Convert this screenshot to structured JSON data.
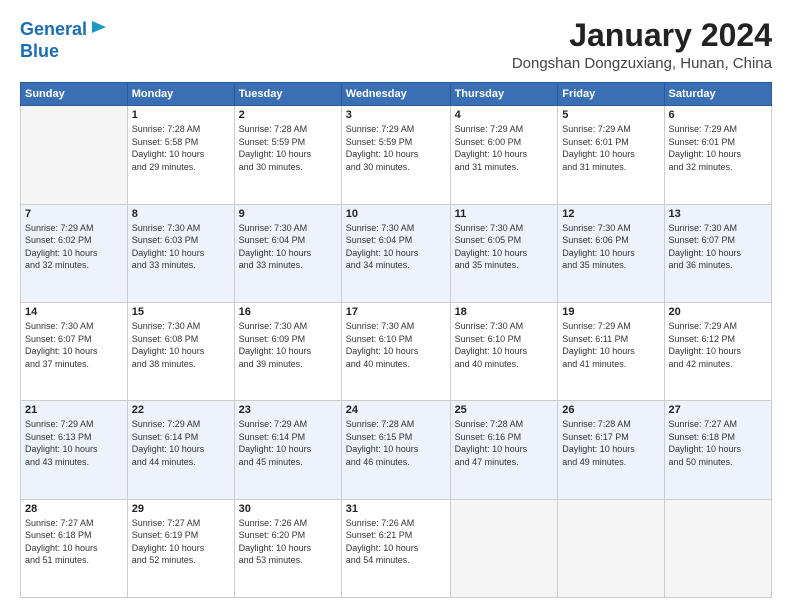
{
  "header": {
    "logo_line1": "General",
    "logo_line2": "Blue",
    "month_title": "January 2024",
    "location": "Dongshan Dongzuxiang, Hunan, China"
  },
  "weekdays": [
    "Sunday",
    "Monday",
    "Tuesday",
    "Wednesday",
    "Thursday",
    "Friday",
    "Saturday"
  ],
  "weeks": [
    [
      {
        "day": "",
        "info": ""
      },
      {
        "day": "1",
        "info": "Sunrise: 7:28 AM\nSunset: 5:58 PM\nDaylight: 10 hours\nand 29 minutes."
      },
      {
        "day": "2",
        "info": "Sunrise: 7:28 AM\nSunset: 5:59 PM\nDaylight: 10 hours\nand 30 minutes."
      },
      {
        "day": "3",
        "info": "Sunrise: 7:29 AM\nSunset: 5:59 PM\nDaylight: 10 hours\nand 30 minutes."
      },
      {
        "day": "4",
        "info": "Sunrise: 7:29 AM\nSunset: 6:00 PM\nDaylight: 10 hours\nand 31 minutes."
      },
      {
        "day": "5",
        "info": "Sunrise: 7:29 AM\nSunset: 6:01 PM\nDaylight: 10 hours\nand 31 minutes."
      },
      {
        "day": "6",
        "info": "Sunrise: 7:29 AM\nSunset: 6:01 PM\nDaylight: 10 hours\nand 32 minutes."
      }
    ],
    [
      {
        "day": "7",
        "info": "Sunrise: 7:29 AM\nSunset: 6:02 PM\nDaylight: 10 hours\nand 32 minutes."
      },
      {
        "day": "8",
        "info": "Sunrise: 7:30 AM\nSunset: 6:03 PM\nDaylight: 10 hours\nand 33 minutes."
      },
      {
        "day": "9",
        "info": "Sunrise: 7:30 AM\nSunset: 6:04 PM\nDaylight: 10 hours\nand 33 minutes."
      },
      {
        "day": "10",
        "info": "Sunrise: 7:30 AM\nSunset: 6:04 PM\nDaylight: 10 hours\nand 34 minutes."
      },
      {
        "day": "11",
        "info": "Sunrise: 7:30 AM\nSunset: 6:05 PM\nDaylight: 10 hours\nand 35 minutes."
      },
      {
        "day": "12",
        "info": "Sunrise: 7:30 AM\nSunset: 6:06 PM\nDaylight: 10 hours\nand 35 minutes."
      },
      {
        "day": "13",
        "info": "Sunrise: 7:30 AM\nSunset: 6:07 PM\nDaylight: 10 hours\nand 36 minutes."
      }
    ],
    [
      {
        "day": "14",
        "info": "Sunrise: 7:30 AM\nSunset: 6:07 PM\nDaylight: 10 hours\nand 37 minutes."
      },
      {
        "day": "15",
        "info": "Sunrise: 7:30 AM\nSunset: 6:08 PM\nDaylight: 10 hours\nand 38 minutes."
      },
      {
        "day": "16",
        "info": "Sunrise: 7:30 AM\nSunset: 6:09 PM\nDaylight: 10 hours\nand 39 minutes."
      },
      {
        "day": "17",
        "info": "Sunrise: 7:30 AM\nSunset: 6:10 PM\nDaylight: 10 hours\nand 40 minutes."
      },
      {
        "day": "18",
        "info": "Sunrise: 7:30 AM\nSunset: 6:10 PM\nDaylight: 10 hours\nand 40 minutes."
      },
      {
        "day": "19",
        "info": "Sunrise: 7:29 AM\nSunset: 6:11 PM\nDaylight: 10 hours\nand 41 minutes."
      },
      {
        "day": "20",
        "info": "Sunrise: 7:29 AM\nSunset: 6:12 PM\nDaylight: 10 hours\nand 42 minutes."
      }
    ],
    [
      {
        "day": "21",
        "info": "Sunrise: 7:29 AM\nSunset: 6:13 PM\nDaylight: 10 hours\nand 43 minutes."
      },
      {
        "day": "22",
        "info": "Sunrise: 7:29 AM\nSunset: 6:14 PM\nDaylight: 10 hours\nand 44 minutes."
      },
      {
        "day": "23",
        "info": "Sunrise: 7:29 AM\nSunset: 6:14 PM\nDaylight: 10 hours\nand 45 minutes."
      },
      {
        "day": "24",
        "info": "Sunrise: 7:28 AM\nSunset: 6:15 PM\nDaylight: 10 hours\nand 46 minutes."
      },
      {
        "day": "25",
        "info": "Sunrise: 7:28 AM\nSunset: 6:16 PM\nDaylight: 10 hours\nand 47 minutes."
      },
      {
        "day": "26",
        "info": "Sunrise: 7:28 AM\nSunset: 6:17 PM\nDaylight: 10 hours\nand 49 minutes."
      },
      {
        "day": "27",
        "info": "Sunrise: 7:27 AM\nSunset: 6:18 PM\nDaylight: 10 hours\nand 50 minutes."
      }
    ],
    [
      {
        "day": "28",
        "info": "Sunrise: 7:27 AM\nSunset: 6:18 PM\nDaylight: 10 hours\nand 51 minutes."
      },
      {
        "day": "29",
        "info": "Sunrise: 7:27 AM\nSunset: 6:19 PM\nDaylight: 10 hours\nand 52 minutes."
      },
      {
        "day": "30",
        "info": "Sunrise: 7:26 AM\nSunset: 6:20 PM\nDaylight: 10 hours\nand 53 minutes."
      },
      {
        "day": "31",
        "info": "Sunrise: 7:26 AM\nSunset: 6:21 PM\nDaylight: 10 hours\nand 54 minutes."
      },
      {
        "day": "",
        "info": ""
      },
      {
        "day": "",
        "info": ""
      },
      {
        "day": "",
        "info": ""
      }
    ]
  ]
}
